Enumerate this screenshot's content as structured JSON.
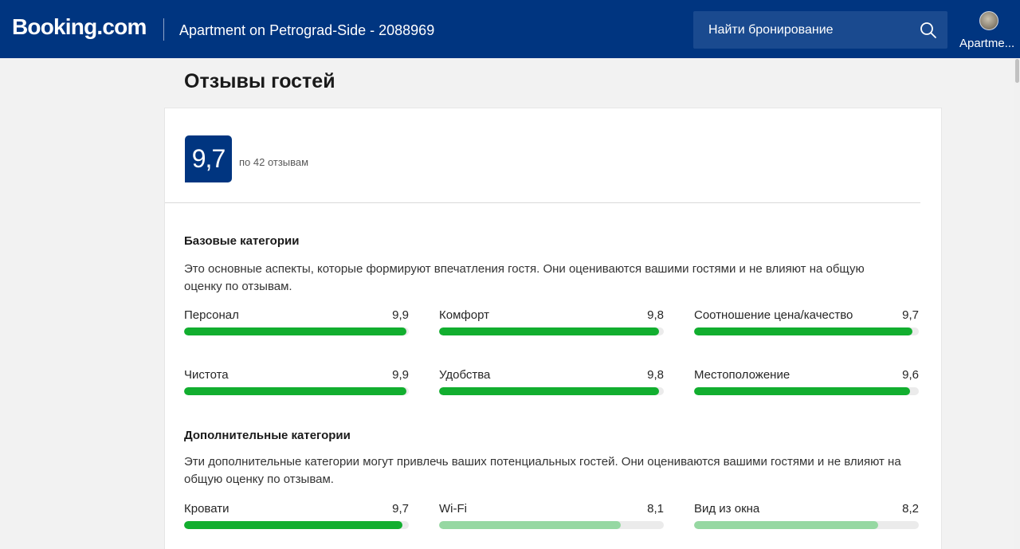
{
  "header": {
    "logo": "Booking.com",
    "property_title": "Apartment on Petrograd-Side - 2088969",
    "search_placeholder": "Найти бронирование",
    "account_label": "Apartme..."
  },
  "page": {
    "title": "Отзывы гостей"
  },
  "score": {
    "value": "9,7",
    "subtitle": "по 42 отзывам"
  },
  "basic": {
    "title": "Базовые категории",
    "description": "Это основные аспекты, которые формируют впечатления гостя. Они оцениваются вашими гостями и не влияют на общую оценку по отзывам.",
    "metrics": [
      {
        "label": "Персонал",
        "value": "9,9",
        "score": 9.9
      },
      {
        "label": "Комфорт",
        "value": "9,8",
        "score": 9.8
      },
      {
        "label": "Соотношение цена/качество",
        "value": "9,7",
        "score": 9.7
      },
      {
        "label": "Чистота",
        "value": "9,9",
        "score": 9.9
      },
      {
        "label": "Удобства",
        "value": "9,8",
        "score": 9.8
      },
      {
        "label": "Местоположение",
        "value": "9,6",
        "score": 9.6
      }
    ]
  },
  "additional": {
    "title": "Дополнительные категории",
    "description": "Эти дополнительные категории могут привлечь ваших потенциальных гостей. Они оцениваются вашими гостями и не влияют на общую оценку по отзывам.",
    "metrics": [
      {
        "label": "Кровати",
        "value": "9,7",
        "score": 9.7
      },
      {
        "label": "Wi-Fi",
        "value": "8,1",
        "score": 8.1
      },
      {
        "label": "Вид из окна",
        "value": "8,2",
        "score": 8.2
      }
    ]
  },
  "colors": {
    "brand": "#003580",
    "bar_high": "#12ae2f",
    "bar_low": "#96d8a2",
    "bar_track": "#ebebeb"
  }
}
